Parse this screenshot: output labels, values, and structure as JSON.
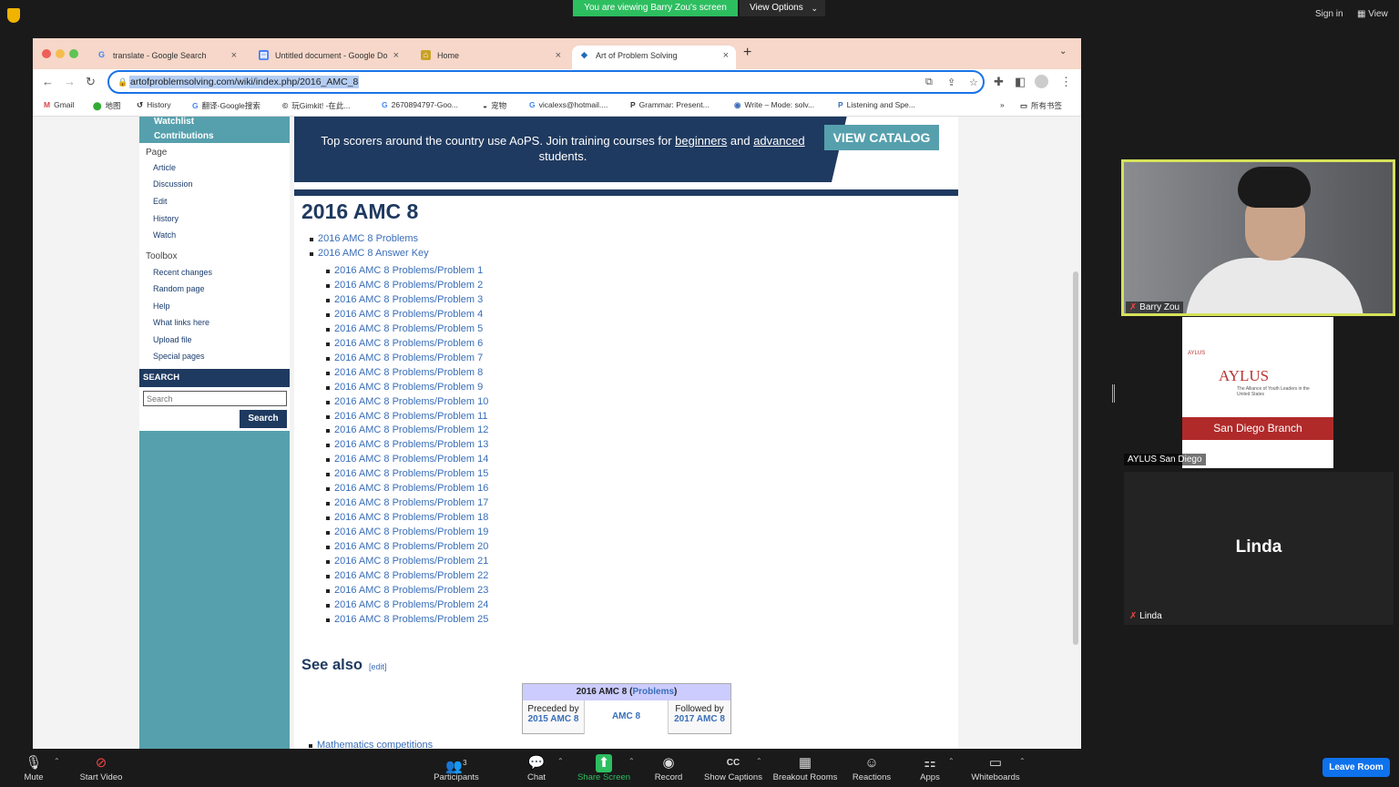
{
  "zoom_top": {
    "viewing_banner": "You are viewing Barry Zou's screen",
    "view_options": "View Options",
    "sign_in": "Sign in",
    "view": "View"
  },
  "tabs": [
    {
      "label": "translate - Google Search",
      "icon": "G"
    },
    {
      "label": "Untitled document - Google Do",
      "icon": "▤"
    },
    {
      "label": "Home",
      "icon": "⌂"
    },
    {
      "label": "Art of Problem Solving",
      "icon": "◆"
    }
  ],
  "url": "artofproblemsolving.com/wiki/index.php/2016_AMC_8",
  "bookmarks": [
    {
      "label": "Gmail",
      "icon": "M"
    },
    {
      "label": "地图",
      "icon": "⬤"
    },
    {
      "label": "History",
      "icon": "↺"
    },
    {
      "label": "翻译-Google搜索",
      "icon": "G"
    },
    {
      "label": "玩Gimkit! -在此...",
      "icon": "©"
    },
    {
      "label": "2670894797-Goo...",
      "icon": "G"
    },
    {
      "label": "宠物",
      "icon": "◒"
    },
    {
      "label": "vicalexs@hotmail....",
      "icon": "G"
    },
    {
      "label": "Grammar: Present...",
      "icon": "P"
    },
    {
      "label": "Write – Mode: solv...",
      "icon": "◉"
    },
    {
      "label": "Listening and Spe...",
      "icon": "P"
    }
  ],
  "bookmarks_more": "»",
  "bookmarks_folder": "所有书签",
  "sidebar": {
    "top_links": [
      "Watchlist",
      "Contributions"
    ],
    "page_heading": "Page",
    "page_items": [
      "Article",
      "Discussion",
      "Edit",
      "History",
      "Watch"
    ],
    "toolbox_heading": "Toolbox",
    "toolbox_items": [
      "Recent changes",
      "Random page",
      "Help",
      "What links here",
      "Upload file",
      "Special pages"
    ],
    "search_heading": "SEARCH",
    "search_placeholder": "Search",
    "search_button": "Search"
  },
  "banner": {
    "text_pre": "Top scorers around the country use AoPS. Join training courses for ",
    "link1": "beginners",
    "mid": " and ",
    "link2": "advanced",
    "text_post": " students.",
    "catalog": "VIEW CATALOG"
  },
  "article": {
    "title": "2016 AMC 8",
    "top_links": [
      "2016 AMC 8 Problems",
      "2016 AMC 8 Answer Key"
    ],
    "problems": [
      "2016 AMC 8 Problems/Problem 1",
      "2016 AMC 8 Problems/Problem 2",
      "2016 AMC 8 Problems/Problem 3",
      "2016 AMC 8 Problems/Problem 4",
      "2016 AMC 8 Problems/Problem 5",
      "2016 AMC 8 Problems/Problem 6",
      "2016 AMC 8 Problems/Problem 7",
      "2016 AMC 8 Problems/Problem 8",
      "2016 AMC 8 Problems/Problem 9",
      "2016 AMC 8 Problems/Problem 10",
      "2016 AMC 8 Problems/Problem 11",
      "2016 AMC 8 Problems/Problem 12",
      "2016 AMC 8 Problems/Problem 13",
      "2016 AMC 8 Problems/Problem 14",
      "2016 AMC 8 Problems/Problem 15",
      "2016 AMC 8 Problems/Problem 16",
      "2016 AMC 8 Problems/Problem 17",
      "2016 AMC 8 Problems/Problem 18",
      "2016 AMC 8 Problems/Problem 19",
      "2016 AMC 8 Problems/Problem 20",
      "2016 AMC 8 Problems/Problem 21",
      "2016 AMC 8 Problems/Problem 22",
      "2016 AMC 8 Problems/Problem 23",
      "2016 AMC 8 Problems/Problem 24",
      "2016 AMC 8 Problems/Problem 25"
    ],
    "see_also": "See also",
    "edit": "[edit]",
    "nav_table": {
      "head": "2016 AMC 8 (",
      "head_link": "Problems",
      "head_close": ")",
      "preceded_label": "Preceded by",
      "preceded_link": "2015 AMC 8",
      "center": "AMC 8",
      "followed_label": "Followed by",
      "followed_link": "2017 AMC 8"
    },
    "bottom_link": "Mathematics competitions"
  },
  "participants": [
    {
      "name": "Barry Zou"
    },
    {
      "name": "AYLUS San Diego",
      "logo_text": "AYLUS",
      "logo_small": "AYLUS",
      "logo_sub": "The Alliance of Youth Leaders in the United States",
      "branch": "San Diego Branch"
    },
    {
      "name": "Linda",
      "display": "Linda"
    }
  ],
  "zoom_bottom": [
    {
      "label": "Mute",
      "icon": "🎤"
    },
    {
      "label": "Start Video",
      "icon": "▶"
    },
    {
      "label": "Participants",
      "icon": "👥",
      "count": "3"
    },
    {
      "label": "Chat",
      "icon": "💬"
    },
    {
      "label": "Share Screen",
      "icon": "⬆"
    },
    {
      "label": "Record",
      "icon": "◉"
    },
    {
      "label": "Show Captions",
      "icon": "CC"
    },
    {
      "label": "Breakout Rooms",
      "icon": "▦"
    },
    {
      "label": "Reactions",
      "icon": "☺"
    },
    {
      "label": "Apps",
      "icon": "⚏"
    },
    {
      "label": "Whiteboards",
      "icon": "▭"
    }
  ],
  "leave": "Leave Room"
}
